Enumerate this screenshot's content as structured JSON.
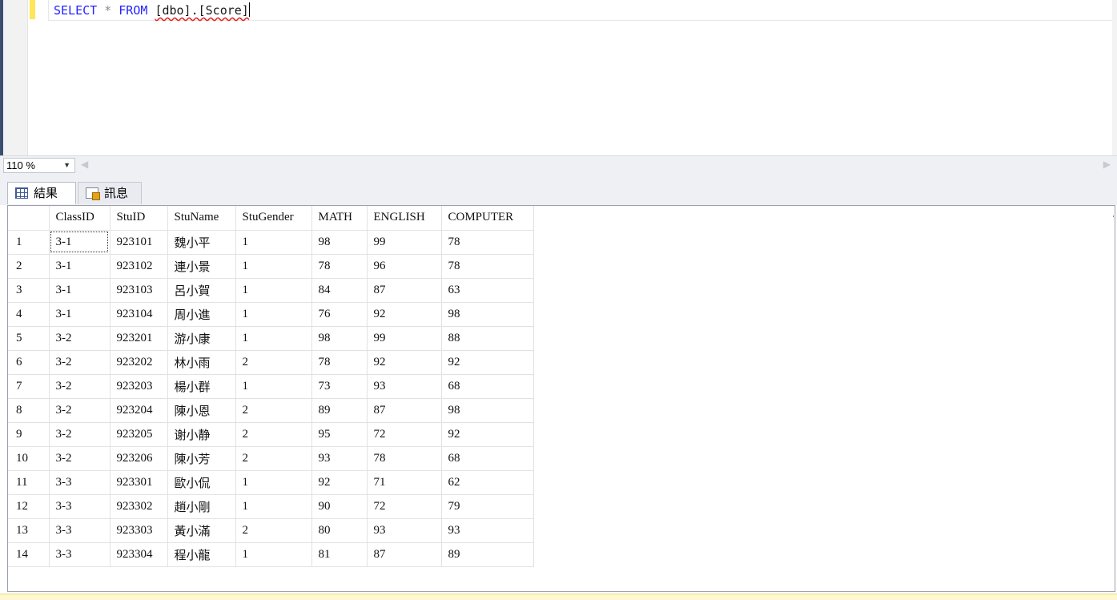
{
  "editor": {
    "sql_keyword_select": "SELECT",
    "sql_star": "*",
    "sql_keyword_from": "FROM",
    "sql_table": "[dbo].[Score]"
  },
  "zoom": {
    "level": "110 %"
  },
  "tabs": [
    {
      "label": "結果",
      "icon": "results-grid-icon"
    },
    {
      "label": "訊息",
      "icon": "messages-icon"
    }
  ],
  "results": {
    "columns": [
      "ClassID",
      "StuID",
      "StuName",
      "StuGender",
      "MATH",
      "ENGLISH",
      "COMPUTER"
    ],
    "rows": [
      [
        "1",
        "3-1",
        "923101",
        "魏小平",
        "1",
        "98",
        "99",
        "78"
      ],
      [
        "2",
        "3-1",
        "923102",
        "連小景",
        "1",
        "78",
        "96",
        "78"
      ],
      [
        "3",
        "3-1",
        "923103",
        "呂小賀",
        "1",
        "84",
        "87",
        "63"
      ],
      [
        "4",
        "3-1",
        "923104",
        "周小進",
        "1",
        "76",
        "92",
        "98"
      ],
      [
        "5",
        "3-2",
        "923201",
        "游小康",
        "1",
        "98",
        "99",
        "88"
      ],
      [
        "6",
        "3-2",
        "923202",
        "林小雨",
        "2",
        "78",
        "92",
        "92"
      ],
      [
        "7",
        "3-2",
        "923203",
        "楊小群",
        "1",
        "73",
        "93",
        "68"
      ],
      [
        "8",
        "3-2",
        "923204",
        "陳小恩",
        "2",
        "89",
        "87",
        "98"
      ],
      [
        "9",
        "3-2",
        "923205",
        "谢小静",
        "2",
        "95",
        "72",
        "92"
      ],
      [
        "10",
        "3-2",
        "923206",
        "陳小芳",
        "2",
        "93",
        "78",
        "68"
      ],
      [
        "11",
        "3-3",
        "923301",
        "歐小侃",
        "1",
        "92",
        "71",
        "62"
      ],
      [
        "12",
        "3-3",
        "923302",
        "趙小剛",
        "1",
        "90",
        "72",
        "79"
      ],
      [
        "13",
        "3-3",
        "923303",
        "黃小滿",
        "2",
        "80",
        "93",
        "93"
      ],
      [
        "14",
        "3-3",
        "923304",
        "程小龍",
        "1",
        "81",
        "87",
        "89"
      ]
    ]
  }
}
